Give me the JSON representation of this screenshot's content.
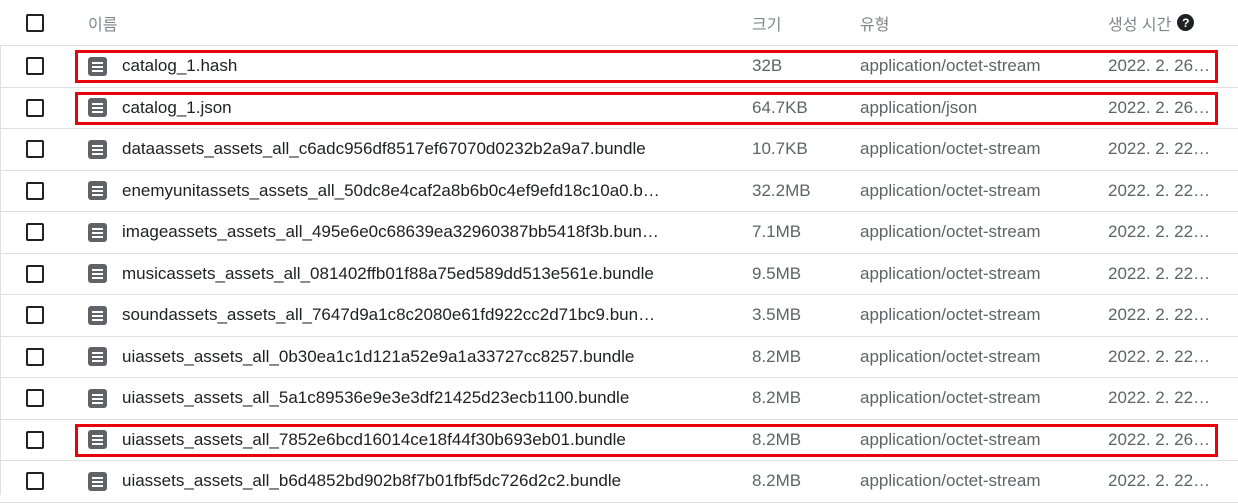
{
  "header": {
    "name_label": "이름",
    "size_label": "크기",
    "type_label": "유형",
    "created_label": "생성 시간",
    "help_glyph": "?"
  },
  "files": [
    {
      "name": "catalog_1.hash",
      "size": "32B",
      "type": "application/octet-stream",
      "created": "2022. 2. 26…",
      "highlighted": true
    },
    {
      "name": "catalog_1.json",
      "size": "64.7KB",
      "type": "application/json",
      "created": "2022. 2. 26…",
      "highlighted": true
    },
    {
      "name": "dataassets_assets_all_c6adc956df8517ef67070d0232b2a9a7.bundle",
      "size": "10.7KB",
      "type": "application/octet-stream",
      "created": "2022. 2. 22…",
      "highlighted": false
    },
    {
      "name": "enemyunitassets_assets_all_50dc8e4caf2a8b6b0c4ef9efd18c10a0.b…",
      "size": "32.2MB",
      "type": "application/octet-stream",
      "created": "2022. 2. 22…",
      "highlighted": false
    },
    {
      "name": "imageassets_assets_all_495e6e0c68639ea32960387bb5418f3b.bun…",
      "size": "7.1MB",
      "type": "application/octet-stream",
      "created": "2022. 2. 22…",
      "highlighted": false
    },
    {
      "name": "musicassets_assets_all_081402ffb01f88a75ed589dd513e561e.bundle",
      "size": "9.5MB",
      "type": "application/octet-stream",
      "created": "2022. 2. 22…",
      "highlighted": false
    },
    {
      "name": "soundassets_assets_all_7647d9a1c8c2080e61fd922cc2d71bc9.bun…",
      "size": "3.5MB",
      "type": "application/octet-stream",
      "created": "2022. 2. 22…",
      "highlighted": false
    },
    {
      "name": "uiassets_assets_all_0b30ea1c1d121a52e9a1a33727cc8257.bundle",
      "size": "8.2MB",
      "type": "application/octet-stream",
      "created": "2022. 2. 22…",
      "highlighted": false
    },
    {
      "name": "uiassets_assets_all_5a1c89536e9e3e3df21425d23ecb1100.bundle",
      "size": "8.2MB",
      "type": "application/octet-stream",
      "created": "2022. 2. 22…",
      "highlighted": false
    },
    {
      "name": "uiassets_assets_all_7852e6bcd16014ce18f44f30b693eb01.bundle",
      "size": "8.2MB",
      "type": "application/octet-stream",
      "created": "2022. 2. 26…",
      "highlighted": true
    },
    {
      "name": "uiassets_assets_all_b6d4852bd902b8f7b01fbf5dc726d2c2.bundle",
      "size": "8.2MB",
      "type": "application/octet-stream",
      "created": "2022. 2. 22…",
      "highlighted": false
    }
  ],
  "colors": {
    "highlight": "#e8000b",
    "icon": "#5f6368"
  },
  "icons": {
    "file": "file-document-icon",
    "help": "help-circle-icon"
  }
}
